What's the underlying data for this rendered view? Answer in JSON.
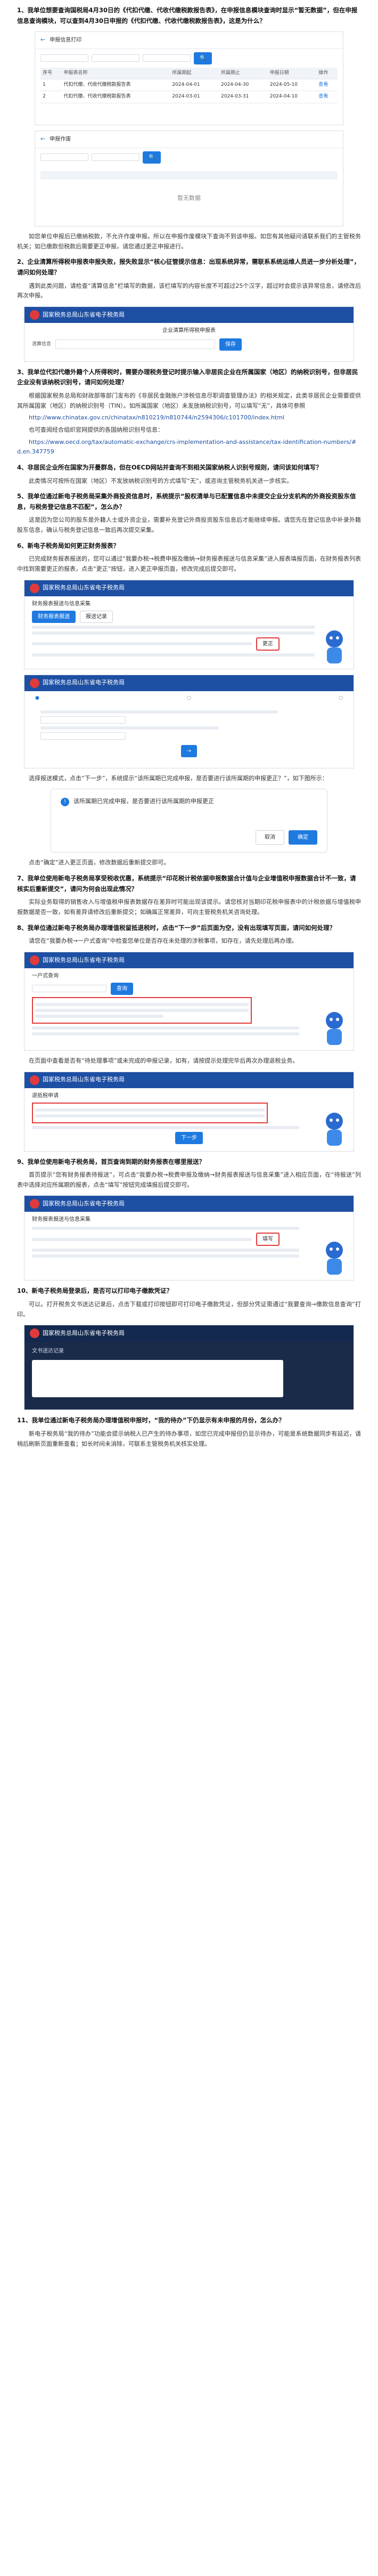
{
  "q1": {
    "title": "1、我单位想要查询国税局4月30日的《代扣代缴、代收代缴税款报告表》，在申报信息模块查询时显示“暂无数据”，但在申报信息查询模块，可以查到4月30日申报的《代扣代缴、代收代缴税款报告表》，这是为什么？",
    "shot1": {
      "title": "申报信息打印",
      "cols": [
        "序号",
        "申报表名称",
        "所属期起",
        "所属期止",
        "申报日期",
        "操作"
      ],
      "rows": [
        [
          "1",
          "代扣代缴、代收代缴税款报告表",
          "2024-04-01",
          "2024-04-30",
          "2024-05-10",
          "查看"
        ],
        [
          "2",
          "代扣代缴、代收代缴税款报告表",
          "2024-03-01",
          "2024-03-31",
          "2024-04-10",
          "查看"
        ]
      ]
    },
    "shot2": {
      "title": "申报作废",
      "empty": "暂无数据"
    },
    "answer": "如您单位申报后已缴纳税款，不允许作废申报。所以在申报作废模块下查询不到该申报。如您有其他疑问请联系我们的主管税务机关；如已缴款但税款后需要更正申报，请您通过更正申报进行。"
  },
  "q2": {
    "title": "2、企业清算所得税申报表申报失败，报失败显示“核心征管提示信息：出现系统异常，需联系系统运维人员进一步分析处理”，请问如何处理？",
    "answer1": "遇到此类问题，请检查“清算信息”栏填写的数据，该栏填写的内容长度不可超过25个汉字，超过时会提示该异常信息，请修改后再次申报。",
    "shot": {
      "portal": "国家税务总局山东省电子税务局",
      "form_title": "企业清算所得税申报表",
      "field_label": "清算信息",
      "button": "保存"
    }
  },
  "q3": {
    "title": "3、我单位代扣代缴外籍个人所得税时，需要办理税务登记时提示输入非居民企业在所属国家（地区）的纳税识别号，但非居民企业没有该纳税识别号，请问如何处理？",
    "answer1": "根据国家税务总局和财政部等部门发布的《非居民金融账户涉税信息尽职调查管理办法》的相关规定，此类非居民企业需要提供其所属国家（地区）的纳税识别号（TIN）。如所属国家（地区）未发放纳税识别号，可以填写“无”，具体可参照",
    "link1": "http://www.chinatax.gov.cn/chinatax/n810219/n810744/n2594306/c101700/index.html",
    "answer2": "也可查阅经合组织官网提供的各国纳税识别号信息：",
    "link2": "https://www.oecd.org/tax/automatic-exchange/crs-implementation-and-assistance/tax-identification-numbers/#d.en.347759"
  },
  "q4": {
    "title": "4、非居民企业所在国家为开曼群岛，但在OECD网站并查询不到相关国家纳税人识别号规则，请问该如何填写？",
    "answer": "此类情况可按所在国家（地区）不发放纳税识别号的方式填写“无”，或咨询主管税务机关进一步核实。"
  },
  "q5": {
    "title": "5、我单位通过新电子税务局采集外商投资信息时，系统提示“股权清单与已配置信息中未提交企业分支机构的外商投资股东信息，与税务登记信息不匹配”，怎么办？",
    "answer": "这是因为您公司的股东是外籍人士或外资企业，需要补充登记外商投资股东信息后才能继续申报。请您先在登记信息中补录外籍股东信息，确认与税务登记信息一致后再次提交采集。"
  },
  "q6": {
    "title": "6、新电子税务局如何更正财务报表？",
    "answer1": "已完成财务报表报送的，您可以通过“我要办税→税费申报及缴纳→财务报表报送与信息采集”进入报表填报页面，在财务报表列表中找到需要更正的报表，点击“更正”按钮，进入更正申报页面，修改完成后提交即可。",
    "shot": {
      "portal": "国家税务总局山东省电子税务局",
      "menu": "财务报表报送与信息采集",
      "tabs": [
        "财务报表报送",
        "报送记录"
      ],
      "button": "更正"
    },
    "answer2": "选择报送模式，点击“下一步”，系统提示“该所属期已完成申报，是否要进行该所属期的申报更正？”，如下图所示：",
    "dialog": {
      "text": "该所属期已完成申报，是否要进行该所属期的申报更正",
      "cancel": "取消",
      "ok": "确定"
    },
    "answer3": "点击“确定”进入更正页面，修改数据后重新提交即可。"
  },
  "q7": {
    "title": "7、我单位使用新电子税务局享受税收优惠，系统提示“印花税计税依据申报数据合计值与企业增值税申报数据合计不一致，请核实后重新提交”，请问为何会出现此情况？",
    "answer": "实际业务取得的销售收入与增值税申报表数据存在差异时可能出现该提示。请您核对当期印花税申报表中的计税依据与增值税申报数据是否一致，如有差异请修改后重新提交；如确属正常差异，可向主管税务机关咨询处理。"
  },
  "q8": {
    "title": "8、我单位通过新电子税务局办理增值税留抵退税时，点击“下一步”后页面为空，没有出现填写页面，请问如何处理？",
    "answer1": "请您在“我要办税→一户式查询”中检查您单位是否存在未处理的涉税事项，如存在，请先处理后再办理。",
    "shot": {
      "portal": "国家税务总局山东省电子税务局",
      "section": "一户式查询",
      "button": "查询"
    },
    "answer2": "在页面中查看是否有“待处理事项”或未完成的申报记录，如有，请按提示处理完毕后再次办理退税业务。",
    "shot2": {
      "portal": "国家税务总局山东省电子税务局",
      "section": "退抵税申请",
      "button": "下一步"
    }
  },
  "q9": {
    "title": "9、我单位使用新电子税务局，首页查询到期的财务报表在哪里报送？",
    "answer": "首页提示“您有财务报表待报送”，可点击“我要办税→税费申报及缴纳→财务报表报送与信息采集”进入相应页面，在“待报送”列表中选择对应所属期的报表，点击“填写”按钮完成填报后提交即可。",
    "shot": {
      "portal": "国家税务总局山东省电子税务局",
      "section": "财务报表报送与信息采集",
      "button": "填写"
    }
  },
  "q10": {
    "title": "10、新电子税务局登录后，是否可以打印电子缴款凭证？",
    "answer": "可以。打开税务文书送达记录后，点击下载或打印按钮即可打印电子缴款凭证，但部分凭证需通过“我要查询→缴款信息查询”打印。",
    "shot": {
      "portal": "国家税务总局山东省电子税务局",
      "section": "文书送达记录"
    }
  },
  "q11": {
    "title": "11、我单位通过新电子税务局办理增值税申报时，“我的待办”下仍显示有未申报的月份，怎么办？",
    "answer": "新电子税务局“我的待办”功能会提示纳税人已产生的待办事项，如您已完成申报但仍显示待办，可能是系统数据同步有延迟，请稍后刷新页面重新查看；如长时间未消除，可联系主管税务机关核实处理。"
  },
  "theme": {
    "accent": "#1d4fa3",
    "alert": "#e03b3b"
  }
}
